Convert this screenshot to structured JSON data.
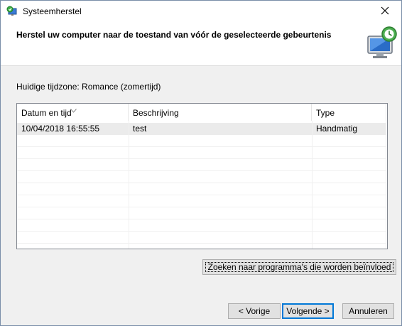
{
  "window": {
    "title": "Systeemherstel",
    "close_icon": "close-icon",
    "app_icon": "system-restore-icon"
  },
  "header": {
    "title": "Herstel uw computer naar de toestand van vóór de geselecteerde gebeurtenis",
    "icon": "system-restore-monitor-icon"
  },
  "timezone_label": "Huidige tijdzone: Romance (zomertijd)",
  "table": {
    "columns": [
      "Datum en tijd",
      "Beschrijving",
      "Type"
    ],
    "sorted_column": "Datum en tijd",
    "sort_icon": "sort-arrow-icon",
    "rows": [
      {
        "date": "10/04/2018 16:55:55",
        "description": "test",
        "type": "Handmatig"
      }
    ]
  },
  "buttons": {
    "scan": "Zoeken naar programma's die worden beïnvloed",
    "back": "< Vorige",
    "next": "Volgende >",
    "cancel": "Annuleren"
  },
  "colors": {
    "accent": "#0078d7",
    "dialog_bg": "#f0f0f0",
    "selected_row": "#ebebeb"
  }
}
